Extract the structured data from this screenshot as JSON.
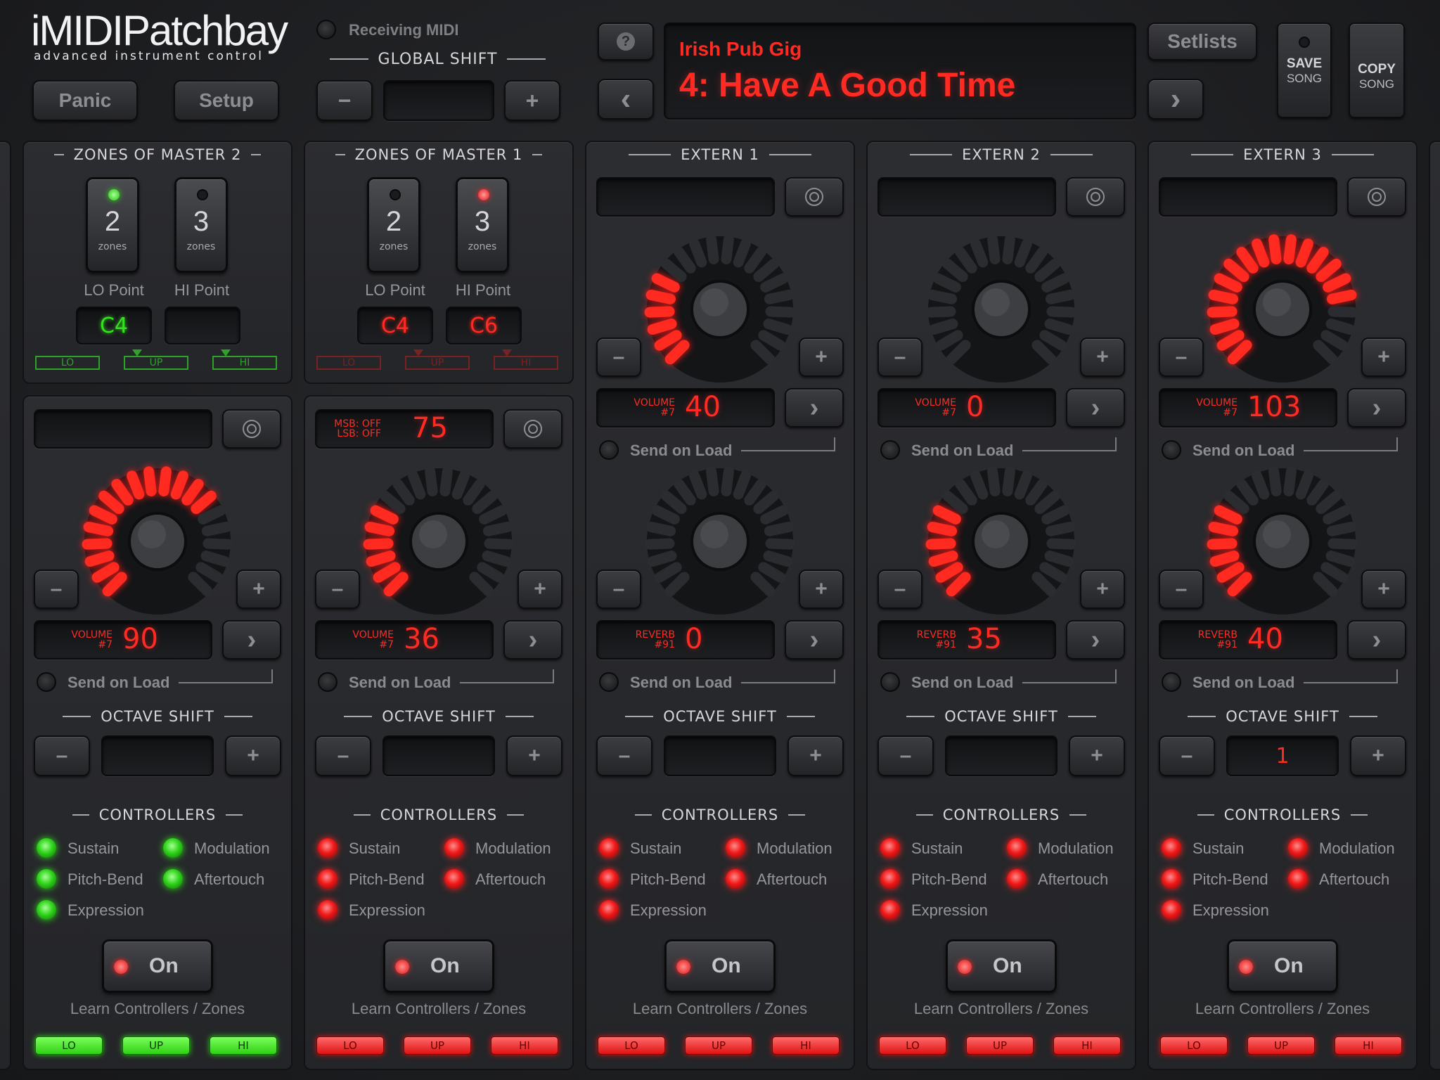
{
  "app": {
    "logo": "iMIDIPatchbay",
    "tagline": "advanced instrument control"
  },
  "header": {
    "receiving_midi": "Receiving MIDI",
    "global_shift": "GLOBAL SHIFT",
    "panic": "Panic",
    "setup": "Setup",
    "minus": "−",
    "plus": "+",
    "help": "?",
    "prev": "‹",
    "next": "›",
    "setlists": "Setlists",
    "save_song": [
      "SAVE",
      "SONG"
    ],
    "copy_song": [
      "COPY",
      "SONG"
    ],
    "setlist_name": "Irish Pub Gig",
    "song_title": "4: Have A Good Time",
    "global_shift_value": ""
  },
  "colors": {
    "accent_red": "#ff2b22",
    "accent_green": "#2fd41a"
  },
  "zones": [
    {
      "title": "ZONES OF MASTER 2",
      "left": {
        "num": "2",
        "sub": "zones",
        "led": "green"
      },
      "right": {
        "num": "3",
        "sub": "zones",
        "led": "off"
      },
      "lo_label": "LO Point",
      "hi_label": "HI Point",
      "lo_value": "C4",
      "hi_value": "",
      "lo_color": "green",
      "strips": [
        "LO",
        "UP",
        "HI"
      ],
      "strip_color": "green"
    },
    {
      "title": "ZONES OF MASTER 1",
      "left": {
        "num": "2",
        "sub": "zones",
        "led": "off"
      },
      "right": {
        "num": "3",
        "sub": "zones",
        "led": "red"
      },
      "lo_label": "LO Point",
      "hi_label": "HI Point",
      "lo_value": "C4",
      "hi_value": "C6",
      "lo_color": "red",
      "strips": [
        "LO",
        "UP",
        "HI"
      ],
      "strip_color": "red"
    }
  ],
  "externs": [
    {
      "title": "EXTERN 1"
    },
    {
      "title": "EXTERN 2"
    },
    {
      "title": "EXTERN 3"
    }
  ],
  "columns": [
    {
      "color": "green",
      "top_knob": null,
      "bottom_knob": {
        "label1": "VOLUME",
        "label2": "#7",
        "value": "90",
        "level": 0.71
      },
      "msb": null,
      "octave_value": ""
    },
    {
      "color": "red",
      "top_knob": null,
      "bottom_knob": {
        "label1": "VOLUME",
        "label2": "#7",
        "value": "36",
        "level": 0.28
      },
      "msb": {
        "l1": "MSB: OFF",
        "l2": "LSB: OFF",
        "value": "75"
      },
      "octave_value": ""
    },
    {
      "color": "red",
      "top_knob": {
        "label1": "VOLUME",
        "label2": "#7",
        "value": "40",
        "level": 0.31
      },
      "bottom_knob": {
        "label1": "REVERB",
        "label2": "#91",
        "value": "0",
        "level": 0.0
      },
      "msb": null,
      "octave_value": ""
    },
    {
      "color": "red",
      "top_knob": {
        "label1": "VOLUME",
        "label2": "#7",
        "value": "0",
        "level": 0.0
      },
      "bottom_knob": {
        "label1": "REVERB",
        "label2": "#91",
        "value": "35",
        "level": 0.28
      },
      "msb": null,
      "octave_value": ""
    },
    {
      "color": "red",
      "top_knob": {
        "label1": "VOLUME",
        "label2": "#7",
        "value": "103",
        "level": 0.81
      },
      "bottom_knob": {
        "label1": "REVERB",
        "label2": "#91",
        "value": "40",
        "level": 0.31
      },
      "msb": null,
      "octave_value": "1"
    }
  ],
  "labels": {
    "send_on_load": "Send on Load",
    "octave_shift": "OCTAVE SHIFT",
    "controllers": "CONTROLLERS",
    "sustain": "Sustain",
    "modulation": "Modulation",
    "pitch_bend": "Pitch-Bend",
    "aftertouch": "Aftertouch",
    "expression": "Expression",
    "on": "On",
    "learn": "Learn Controllers / Zones",
    "minus": "–",
    "plus": "+",
    "next": "›",
    "lo": "LO",
    "up": "UP",
    "hi": "HI"
  }
}
